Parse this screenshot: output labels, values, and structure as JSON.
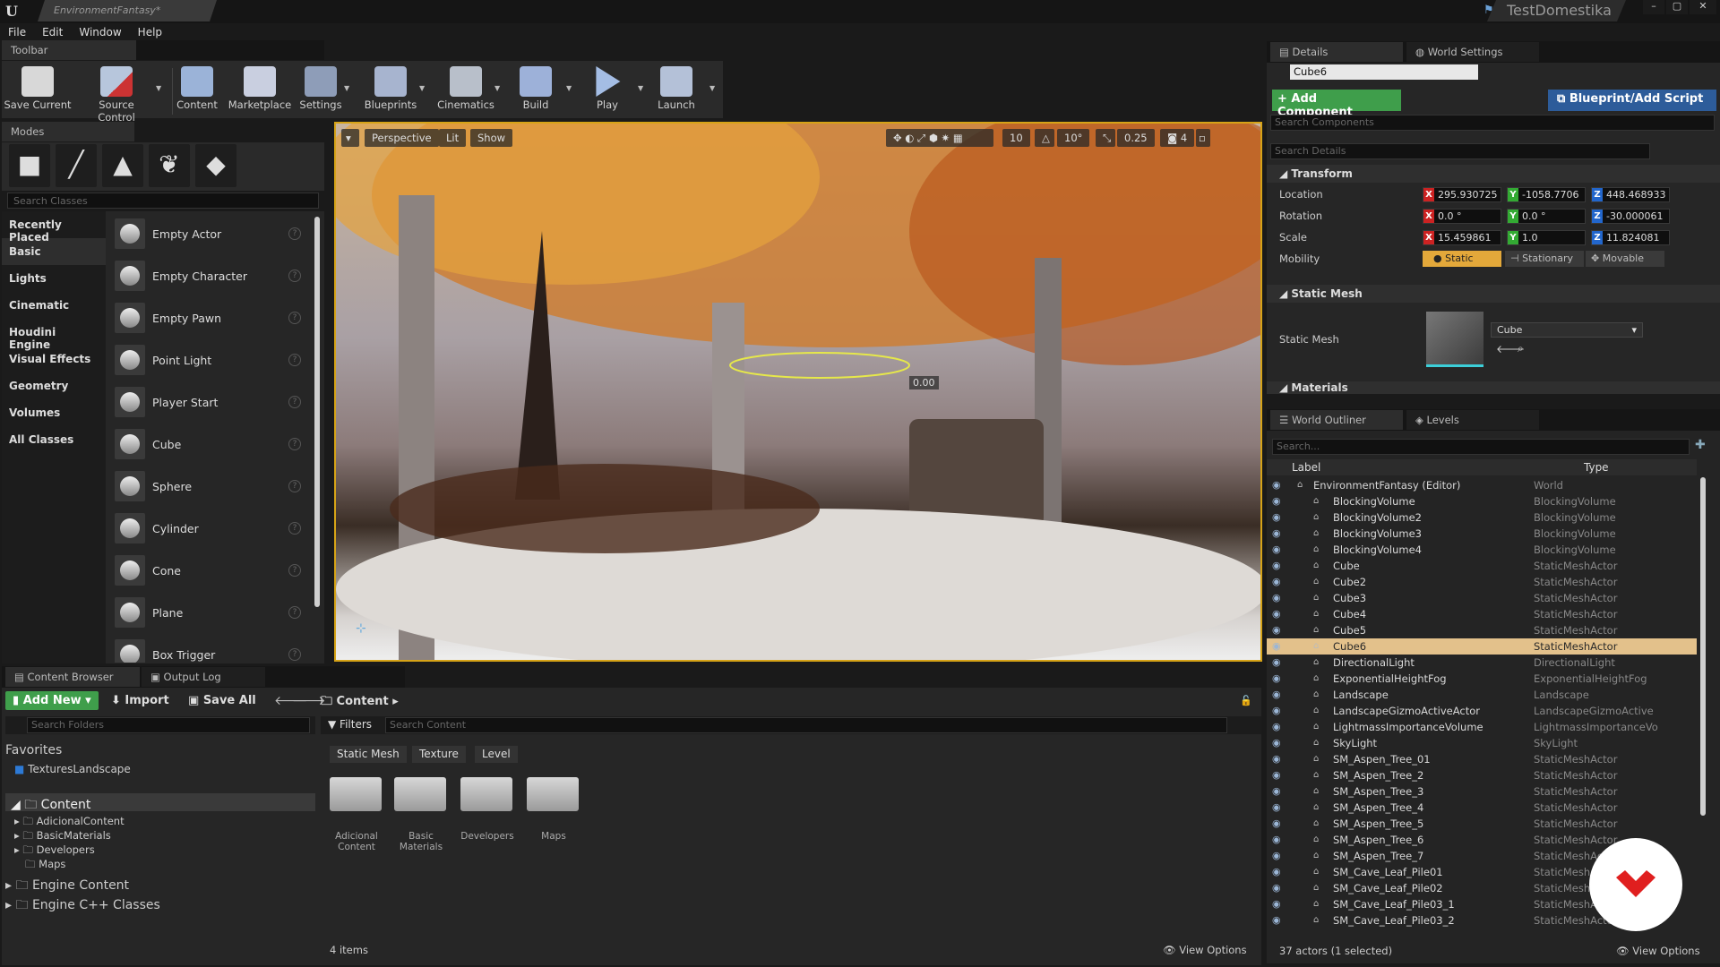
{
  "window": {
    "doc_tab": "EnvironmentFantasy*",
    "project": "TestDomestika"
  },
  "menu": [
    "File",
    "Edit",
    "Window",
    "Help"
  ],
  "toolbar": {
    "tab": "Toolbar",
    "tools": [
      "Save Current",
      "Source Control",
      "Content",
      "Marketplace",
      "Settings",
      "Blueprints",
      "Cinematics",
      "Build",
      "Play",
      "Launch"
    ]
  },
  "modes": {
    "tab": "Modes",
    "search_placeholder": "Search Classes",
    "categories": [
      "Recently Placed",
      "Basic",
      "Lights",
      "Cinematic",
      "Houdini Engine",
      "Visual Effects",
      "Geometry",
      "Volumes",
      "All Classes"
    ],
    "selected_category": "Basic",
    "items": [
      "Empty Actor",
      "Empty Character",
      "Empty Pawn",
      "Point Light",
      "Player Start",
      "Cube",
      "Sphere",
      "Cylinder",
      "Cone",
      "Plane",
      "Box Trigger"
    ]
  },
  "viewport": {
    "perspective": "Perspective",
    "lit": "Lit",
    "show": "Show",
    "grid": "10",
    "rotation": "10°",
    "scale": "0.25",
    "cam_speed": "4",
    "gizmo_value": "0.00"
  },
  "details": {
    "tab": "Details",
    "tab2": "World Settings",
    "object_name": "Cube6",
    "add_component": "+ Add Component",
    "blueprint": "Blueprint/Add Script",
    "search_components": "Search Components",
    "search_details": "Search Details",
    "transform": "Transform",
    "location_label": "Location",
    "rotation_label": "Rotation",
    "scale_label": "Scale",
    "mobility_label": "Mobility",
    "location": [
      "295.930725",
      "-1058.7706",
      "448.468933"
    ],
    "rotation": [
      "0.0 °",
      "0.0 °",
      "-30.000061"
    ],
    "scale": [
      "15.459861",
      "1.0",
      "11.824081"
    ],
    "mobility": [
      "Static",
      "Stationary",
      "Movable"
    ],
    "static_mesh_section": "Static Mesh",
    "static_mesh_label": "Static Mesh",
    "static_mesh_value": "Cube",
    "materials": "Materials"
  },
  "outliner": {
    "tab": "World Outliner",
    "tab2": "Levels",
    "search_placeholder": "Search...",
    "col_label": "Label",
    "col_type": "Type",
    "footer": "37 actors (1 selected)",
    "view_options": "View Options",
    "rows": [
      {
        "label": "EnvironmentFantasy (Editor)",
        "type": "World"
      },
      {
        "label": "BlockingVolume",
        "type": "BlockingVolume"
      },
      {
        "label": "BlockingVolume2",
        "type": "BlockingVolume"
      },
      {
        "label": "BlockingVolume3",
        "type": "BlockingVolume"
      },
      {
        "label": "BlockingVolume4",
        "type": "BlockingVolume"
      },
      {
        "label": "Cube",
        "type": "StaticMeshActor"
      },
      {
        "label": "Cube2",
        "type": "StaticMeshActor"
      },
      {
        "label": "Cube3",
        "type": "StaticMeshActor"
      },
      {
        "label": "Cube4",
        "type": "StaticMeshActor"
      },
      {
        "label": "Cube5",
        "type": "StaticMeshActor"
      },
      {
        "label": "Cube6",
        "type": "StaticMeshActor"
      },
      {
        "label": "DirectionalLight",
        "type": "DirectionalLight"
      },
      {
        "label": "ExponentialHeightFog",
        "type": "ExponentialHeightFog"
      },
      {
        "label": "Landscape",
        "type": "Landscape"
      },
      {
        "label": "LandscapeGizmoActiveActor",
        "type": "LandscapeGizmoActive"
      },
      {
        "label": "LightmassImportanceVolume",
        "type": "LightmassImportanceVo"
      },
      {
        "label": "SkyLight",
        "type": "SkyLight"
      },
      {
        "label": "SM_Aspen_Tree_01",
        "type": "StaticMeshActor"
      },
      {
        "label": "SM_Aspen_Tree_2",
        "type": "StaticMeshActor"
      },
      {
        "label": "SM_Aspen_Tree_3",
        "type": "StaticMeshActor"
      },
      {
        "label": "SM_Aspen_Tree_4",
        "type": "StaticMeshActor"
      },
      {
        "label": "SM_Aspen_Tree_5",
        "type": "StaticMeshActor"
      },
      {
        "label": "SM_Aspen_Tree_6",
        "type": "StaticMeshActor"
      },
      {
        "label": "SM_Aspen_Tree_7",
        "type": "StaticMeshActor"
      },
      {
        "label": "SM_Cave_Leaf_Pile01",
        "type": "StaticMeshActor"
      },
      {
        "label": "SM_Cave_Leaf_Pile02",
        "type": "StaticMeshActor"
      },
      {
        "label": "SM_Cave_Leaf_Pile03_1",
        "type": "StaticMeshActor"
      },
      {
        "label": "SM_Cave_Leaf_Pile03_2",
        "type": "StaticMeshActor"
      }
    ],
    "selected_index": 10
  },
  "content_browser": {
    "tab": "Content Browser",
    "tab2": "Output Log",
    "add_new": "Add New",
    "import": "Import",
    "save_all": "Save All",
    "path": "Content",
    "search_folders": "Search Folders",
    "filters": "Filters",
    "search_content": "Search Content",
    "favorites": "Favorites",
    "fav_item": "TexturesLandscape",
    "root": "Content",
    "children": [
      "AdicionalContent",
      "BasicMaterials",
      "Developers",
      "Maps"
    ],
    "engine_content": "Engine Content",
    "engine_cpp": "Engine C++ Classes",
    "chips": [
      "Static Mesh",
      "Texture",
      "Level"
    ],
    "folders": [
      "Adicional Content",
      "Basic Materials",
      "Developers",
      "Maps"
    ],
    "count": "4 items",
    "view_options": "View Options"
  }
}
